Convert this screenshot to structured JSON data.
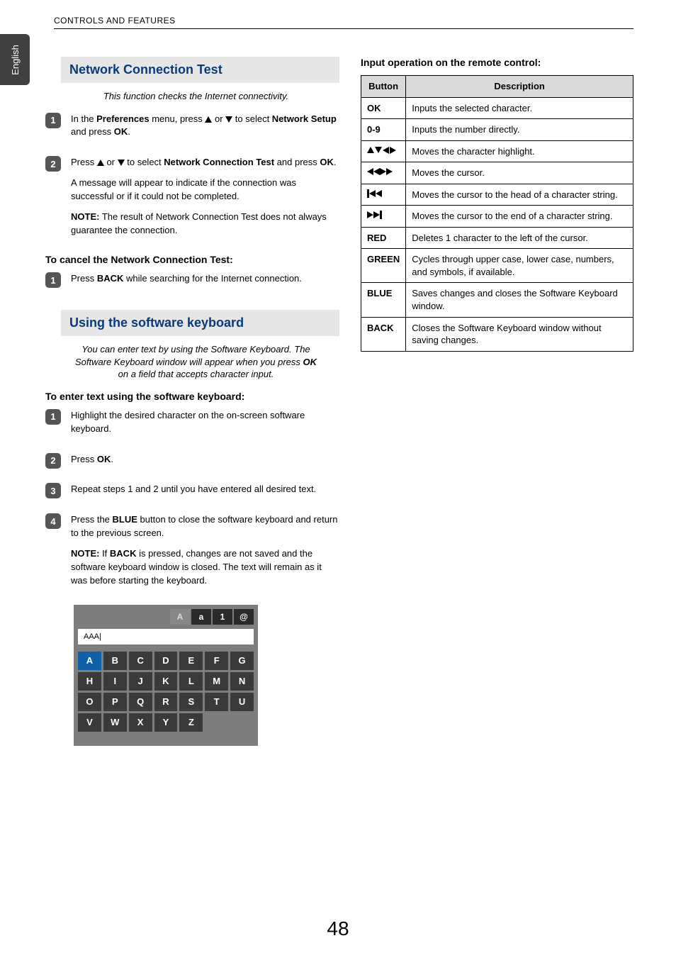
{
  "header": {
    "section_label": "CONTROLS AND FEATURES"
  },
  "lang_tab": "English",
  "left": {
    "nct": {
      "title": "Network Connection Test",
      "intro": "This function checks the Internet connectivity.",
      "step1_a": "In the ",
      "step1_b": "Preferences",
      "step1_c": " menu, press ",
      "step1_d": " or ",
      "step1_e": " to select ",
      "step1_f": "Network Setup",
      "step1_g": " and press ",
      "step1_h": "OK",
      "step1_i": ".",
      "step2_a": "Press ",
      "step2_b": " or ",
      "step2_c": " to select ",
      "step2_d": "Network Connection Test",
      "step2_e": " and press ",
      "step2_f": "OK",
      "step2_g": ".",
      "step2_para": "A message will appear to indicate if the connection was successful or if it could not be completed.",
      "step2_note_a": "NOTE:",
      "step2_note_b": " The result of Network Connection Test does not always guarantee the connection.",
      "cancel_head": "To cancel the Network Connection Test:",
      "cancel_a": "Press ",
      "cancel_b": "BACK",
      "cancel_c": " while searching for the Internet connection."
    },
    "swkb": {
      "title": "Using the software keyboard",
      "intro_a": "You can enter text by using the Software Keyboard. The Software Keyboard window will appear when you press ",
      "intro_b": "OK",
      "intro_c": " on a field that accepts character input.",
      "enter_head": "To enter text using the software keyboard:",
      "s1": "Highlight the desired character on the on-screen software keyboard.",
      "s2_a": "Press ",
      "s2_b": "OK",
      "s2_c": ".",
      "s3": "Repeat steps 1 and 2 until you have entered all desired text.",
      "s4_a": "Press the ",
      "s4_b": "BLUE",
      "s4_c": " button to close the software keyboard and return to the previous screen.",
      "s4_note_a": "NOTE:",
      "s4_note_b": " If ",
      "s4_note_c": "BACK",
      "s4_note_d": " is pressed, changes are not saved and the software keyboard window is closed. The text will remain as it was before starting the keyboard."
    },
    "kb_visual": {
      "top": [
        "A",
        "a",
        "1",
        "@"
      ],
      "input_text": "AAA|",
      "keys": [
        "A",
        "B",
        "C",
        "D",
        "E",
        "F",
        "G",
        "H",
        "I",
        "J",
        "K",
        "L",
        "M",
        "N",
        "O",
        "P",
        "Q",
        "R",
        "S",
        "T",
        "U",
        "V",
        "W",
        "X",
        "Y",
        "Z"
      ]
    }
  },
  "right": {
    "title": "Input operation on the remote control:",
    "table": {
      "head": [
        "Button",
        "Description"
      ],
      "rows": [
        {
          "btn": "OK",
          "desc": "Inputs the selected character.",
          "glyph": "text"
        },
        {
          "btn": "0-9",
          "desc": "Inputs the number directly.",
          "glyph": "text"
        },
        {
          "btn": "nav4",
          "desc": "Moves the character highlight.",
          "glyph": "nav4"
        },
        {
          "btn": "seek",
          "desc": "Moves the cursor.",
          "glyph": "seek"
        },
        {
          "btn": "skip-prev",
          "desc": "Moves the cursor to the head of a character string.",
          "glyph": "skip-prev"
        },
        {
          "btn": "skip-next",
          "desc": "Moves the cursor to the end of a character string.",
          "glyph": "skip-next"
        },
        {
          "btn": "RED",
          "desc": "Deletes 1 character to the left of the cursor.",
          "glyph": "text"
        },
        {
          "btn": "GREEN",
          "desc": "Cycles through upper case, lower case, numbers, and symbols, if available.",
          "glyph": "text"
        },
        {
          "btn": "BLUE",
          "desc": "Saves changes and closes the Software Keyboard window.",
          "glyph": "text"
        },
        {
          "btn": "BACK",
          "desc": "Closes the Software Keyboard window without saving changes.",
          "glyph": "text"
        }
      ]
    }
  },
  "page_number": "48"
}
